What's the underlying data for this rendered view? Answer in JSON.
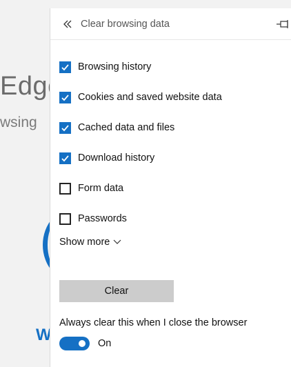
{
  "background_page": {
    "title_fragment": "Edge",
    "subtitle_fragment": "wsing",
    "letter_fragment": "W"
  },
  "panel": {
    "title": "Clear browsing data",
    "back_icon": "double-chevron-left-icon",
    "pin_icon": "pin-icon",
    "options": [
      {
        "label": "Browsing history",
        "checked": true
      },
      {
        "label": "Cookies and saved website data",
        "checked": true
      },
      {
        "label": "Cached data and files",
        "checked": true
      },
      {
        "label": "Download history",
        "checked": true
      },
      {
        "label": "Form data",
        "checked": false
      },
      {
        "label": "Passwords",
        "checked": false
      }
    ],
    "show_more_label": "Show more",
    "clear_button_label": "Clear",
    "always_clear_label": "Always clear this when I close the browser",
    "toggle": {
      "state": "On",
      "on": true
    }
  },
  "colors": {
    "accent": "#1570c4",
    "button_bg": "#cccccc",
    "panel_bg": "#ffffff",
    "page_bg": "#f2f2f2"
  }
}
